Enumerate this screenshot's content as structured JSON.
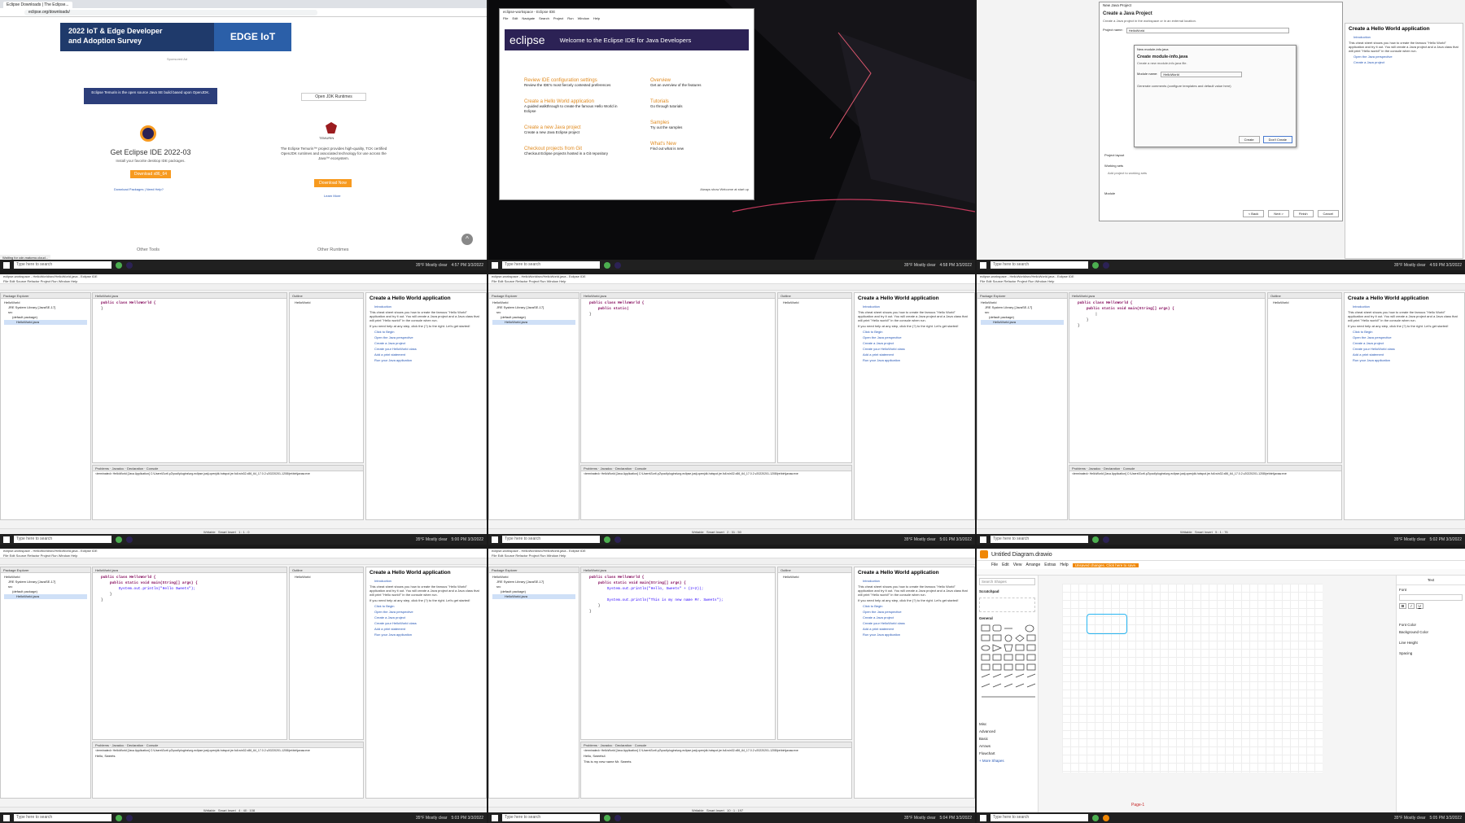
{
  "taskbar": {
    "search_placeholder": "Type here to search",
    "weather": "35°F Mostly clear",
    "clocks": [
      "4:57 PM 3/3/2022",
      "4:58 PM 3/3/2022",
      "4:59 PM 3/3/2022",
      "5:00 PM 3/3/2022",
      "5:01 PM 3/3/2022",
      "5:02 PM 3/3/2022",
      "5:03 PM 3/3/2022",
      "5:04 PM 3/3/2022",
      "5:05 PM 3/3/2022"
    ]
  },
  "colors": {
    "eclipse_purple": "#2c2255",
    "eclipse_orange": "#f79a1f",
    "taskbar": "#202020",
    "drawio_orange": "#f08705"
  },
  "browser": {
    "tab_title": "Eclipse Downloads | The Eclipse...",
    "url": "eclipse.org/downloads/",
    "banner_line1": "2022 IoT & Edge Developer",
    "banner_line2": "and Adoption Survey",
    "banner_tag": "EDGE IoT",
    "ad_caption": "Sponsored Ad",
    "note": "Eclipse Temurin is the open source Java SE build based upon OpenJDK.",
    "heading": "Get Eclipse IDE 2022-03",
    "subheading": "Install your favorite desktop IDE packages.",
    "download_button": "Download x86_64",
    "download_packages": "Download Packages | Need Help?",
    "jdk_tab": "Open JDK Runtimes",
    "temurin_label": "TEMURIN",
    "temurin_desc": "The Eclipse Temurin™ project provides high-quality, TCK certified OpenJDK runtimes and associated technology for use across the Java™ ecosystem.",
    "download_now": "Download Now",
    "learn_more": "Learn More",
    "other_tools": "Other Tools",
    "other_runtimes": "Other Runtimes",
    "status": "Waiting for cdn.matomo.cloud..."
  },
  "welcome": {
    "window_title": "eclipse-workspace - Eclipse IDE",
    "menu": [
      "File",
      "Edit",
      "Navigate",
      "Search",
      "Project",
      "Run",
      "Window",
      "Help"
    ],
    "logo": "eclipse",
    "header": "Welcome to the Eclipse IDE for Java Developers",
    "items_left": [
      {
        "title": "Review IDE configuration settings",
        "desc": "Review the IDE's most fiercely contested preferences"
      },
      {
        "title": "Create a Hello World application",
        "desc": "A guided walkthrough to create the famous Hello World in Eclipse"
      },
      {
        "title": "Create a new Java project",
        "desc": "Create a new Java Eclipse project"
      },
      {
        "title": "Checkout projects from Git",
        "desc": "Checkout Eclipse projects hosted in a Git repository"
      }
    ],
    "items_right": [
      {
        "title": "Overview",
        "desc": "Get an overview of the features"
      },
      {
        "title": "Tutorials",
        "desc": "Go through tutorials"
      },
      {
        "title": "Samples",
        "desc": "Try out the samples"
      },
      {
        "title": "What's New",
        "desc": "Find out what is new"
      }
    ],
    "always_show": "Always show Welcome at start up"
  },
  "new_project": {
    "title": "New Java Project",
    "heading": "Create a Java Project",
    "subheading": "Create a Java project in the workspace or in an external location.",
    "project_name_label": "Project name:",
    "project_name_value": "HelloWorld",
    "module_dialog_title": "New module-info.java",
    "module_heading": "Create module-info.java",
    "module_sub": "Create a new module-info.java file.",
    "module_name_label": "Module name:",
    "module_name_value": "HelloWorld",
    "module_check": "Generate comments (configure templates and default value here)",
    "create_btn": "Create",
    "dont_create_btn": "Don't Create",
    "project_layout": "Project layout",
    "working_sets": "Working sets",
    "add_ws": "Add project to working sets",
    "module": "Module",
    "buttons": [
      "< Back",
      "Next >",
      "Finish",
      "Cancel"
    ]
  },
  "ide": {
    "window_title": "eclipse-workspace - HelloWorld/src/HelloWorld.java - Eclipse IDE",
    "menu": [
      "File",
      "Edit",
      "Source",
      "Refactor",
      "Navigate",
      "Search",
      "Project",
      "Run",
      "Window",
      "Help"
    ],
    "package_explorer": "Package Explorer",
    "tree": [
      "HelloWorld",
      "JRE System Library [JavaSE-17]",
      "src",
      "(default package)",
      "HelloWorld.java"
    ],
    "editor_tab": "HelloWorld.java",
    "outline_tab": "Outline",
    "outline_item": "HelloWorld",
    "cheat_title": "Create a Hello World application",
    "cheat_intro": "Introduction",
    "cheat_text": "This cheat sheet shows you how to create the famous \"Hello World\" application and try it out. You will create a Java project and a Java class that will print \"Hello world!\" in the console when run.",
    "cheat_help": "If you need help at any step, click the (?) to the right. Let's get started!",
    "cheat_click": "Click to Begin",
    "cheat_steps": [
      "Open the Java perspective",
      "Create a Java project",
      "Create your HelloWorld class",
      "Add a print statement",
      "Run your Java application"
    ],
    "bottom_tabs": [
      "Problems",
      "Javadoc",
      "Declaration",
      "Console"
    ],
    "console_line": "<terminated> HelloWorld [Java Application] C:\\Users\\Sort\\.p2\\pool\\plugins\\org.eclipse.justj.openjdk.hotspot.jre.full.win32.x86_64_17.0.2.v20220201-1208\\jre\\bin\\javaw.exe",
    "writable": "Writable",
    "smart_insert": "Smart Insert",
    "positions": [
      "1 : 1 : 0",
      "2 : 31 : 50",
      "5 : 1 : 76",
      "4 : 40 : 108",
      "10 : 1 : 197"
    ],
    "code": {
      "class_line": "public class HelloWorld {",
      "main_partial": "public static|",
      "main_line": "public static void main(String[] args) {",
      "print_line": "System.out.println(\"Hello Sweets\");",
      "print_a": "System.out.println(\"Hello, Sweets\" + (2+2));",
      "print_b": "System.out.println(\"This is my new name Mr. Sweets\");"
    },
    "console_output": [
      "Hello, Sweets",
      "Hello, Sweets4",
      "This is my new name Mr. Sweets"
    ]
  },
  "drawio": {
    "title": "Untitled Diagram.drawio",
    "menu": [
      "File",
      "Edit",
      "View",
      "Arrange",
      "Extras",
      "Help"
    ],
    "warning": "Unsaved changes. Click here to save.",
    "search": "Search Shapes",
    "sections": [
      "Scratchpad",
      "General",
      "Misc",
      "Advanced",
      "Basic",
      "Arrows",
      "Flowchart"
    ],
    "more_shapes": "+ More Shapes",
    "page_tab": "Page-1",
    "panel_tab": "Text",
    "props": [
      "Font",
      "Font Color",
      "Background Color",
      "Line Height",
      "Spacing"
    ]
  }
}
